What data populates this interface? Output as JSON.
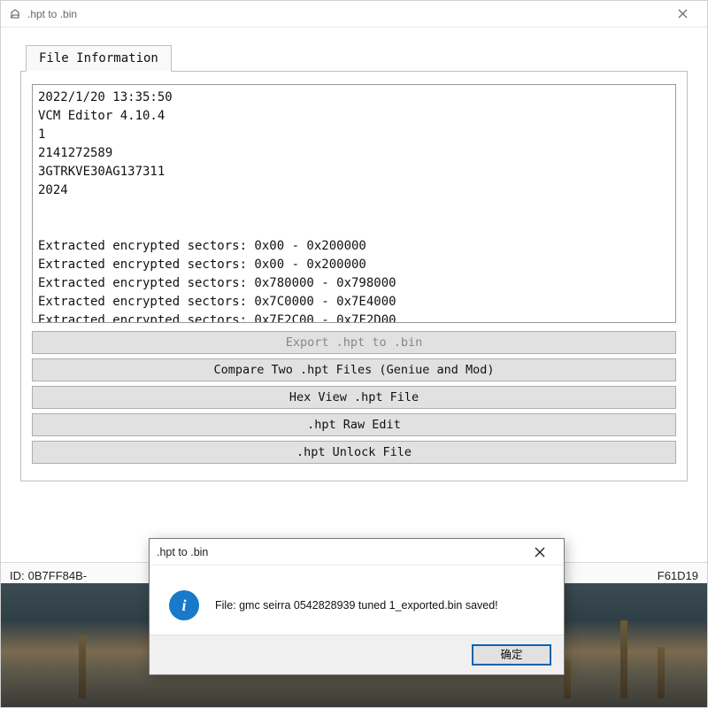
{
  "window": {
    "title": ".hpt to .bin"
  },
  "tab": {
    "label": "File Information"
  },
  "log": {
    "text": "2022/1/20 13:35:50\nVCM Editor 4.10.4\n1\n2141272589\n3GTRKVE30AG137311\n2024\n\n\nExtracted encrypted sectors: 0x00 - 0x200000\nExtracted encrypted sectors: 0x00 - 0x200000\nExtracted encrypted sectors: 0x780000 - 0x798000\nExtracted encrypted sectors: 0x7C0000 - 0x7E4000\nExtracted encrypted sectors: 0x7F2C00 - 0x7F2D00"
  },
  "buttons": {
    "export": "Export .hpt to .bin",
    "compare": "Compare Two .hpt Files (Geniue and Mod)",
    "hexview": "Hex View .hpt File",
    "rawedit": ".hpt Raw Edit",
    "unlock": ".hpt Unlock File"
  },
  "status": {
    "id_label": "ID:",
    "id_left": "0B7FF84B-",
    "id_right": "F61D19"
  },
  "dialog": {
    "title": ".hpt to .bin",
    "message": "File: gmc seirra 0542828939 tuned 1_exported.bin saved!",
    "ok": "确定"
  }
}
